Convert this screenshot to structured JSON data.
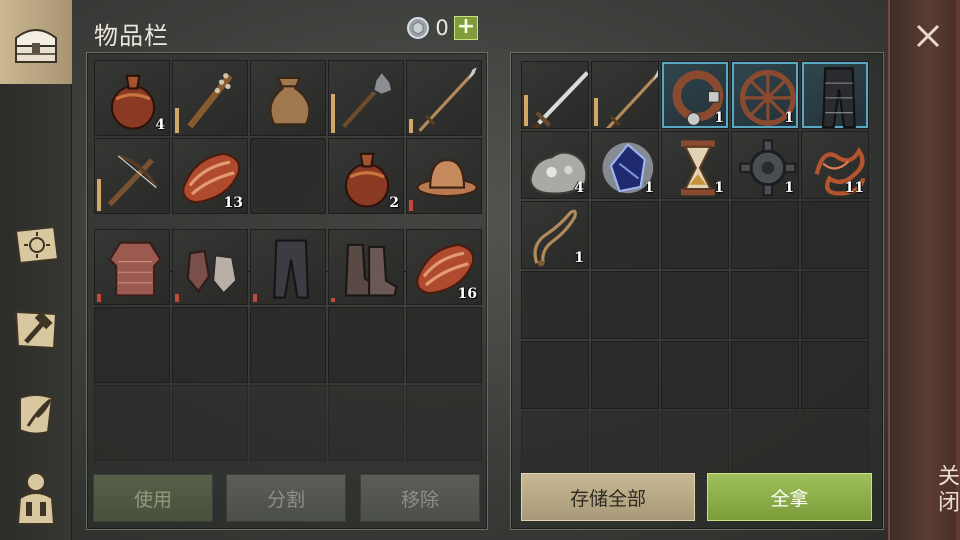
{
  "header": {
    "title": "物品栏",
    "currency": "0"
  },
  "sidebar": {
    "tabs": [
      {
        "name": "inventory",
        "icon": "chest-icon",
        "active": true
      },
      {
        "name": "crafting",
        "icon": "sun-book-icon"
      },
      {
        "name": "building",
        "icon": "hammer-scroll-icon"
      },
      {
        "name": "quests",
        "icon": "quill-scroll-icon"
      },
      {
        "name": "character",
        "icon": "character-icon"
      }
    ]
  },
  "inventory": {
    "slots": [
      {
        "item": "flask-icon",
        "qty": "4"
      },
      {
        "item": "spiked-club-icon",
        "durability": 0.35
      },
      {
        "item": "sack-icon"
      },
      {
        "item": "mace-icon",
        "durability": 0.55
      },
      {
        "item": "spear-icon",
        "durability": 0.2
      },
      {
        "item": "crossbow-icon",
        "durability": 0.45
      },
      {
        "item": "raw-meat-icon",
        "qty": "13"
      },
      {
        "item": ""
      },
      {
        "item": "flask-icon",
        "qty": "2"
      },
      {
        "item": "kettle-hat-icon",
        "durability": 0.15,
        "durability_color": "red"
      }
    ],
    "equip_slots": [
      {
        "item": "chainmail-shirt-icon",
        "durability": 0.12,
        "durability_color": "red"
      },
      {
        "item": "chainmail-gloves-icon",
        "durability": 0.12,
        "durability_color": "red"
      },
      {
        "item": "leather-pants-icon",
        "durability": 0.12,
        "durability_color": "red"
      },
      {
        "item": "boots-icon",
        "durability": 0.06,
        "durability_color": "red"
      },
      {
        "item": "raw-meat-icon",
        "qty": "16"
      }
    ],
    "buttons": {
      "use": "使用",
      "split": "分割",
      "remove": "移除"
    }
  },
  "container": {
    "slots": [
      {
        "item": "longsword-icon",
        "durability": 0.5
      },
      {
        "item": "spear-icon",
        "durability": 0.45
      },
      {
        "item": "leather-collar-icon",
        "qty": "1",
        "highlight": true
      },
      {
        "item": "wagon-wheel-icon",
        "qty": "1",
        "highlight": true
      },
      {
        "item": "chain-leggings-icon",
        "highlight": true
      },
      {
        "item": "silver-ore-icon",
        "qty": "4"
      },
      {
        "item": "sapphire-gem-icon",
        "qty": "1"
      },
      {
        "item": "hourglass-icon",
        "qty": "1"
      },
      {
        "item": "gear-icon",
        "qty": "1"
      },
      {
        "item": "copper-wire-icon",
        "qty": "11"
      },
      {
        "item": "rope-icon",
        "qty": "1"
      }
    ],
    "buttons": {
      "store_all": "存储全部",
      "take_all": "全拿"
    }
  },
  "close": {
    "label": "关闭"
  },
  "colors": {
    "accent_green": "#8fb04a",
    "tan_button": "#bfae8a",
    "highlight_blue": "#58a8c4",
    "durability_tan": "#d1a86a",
    "durability_red": "#c6473b"
  }
}
